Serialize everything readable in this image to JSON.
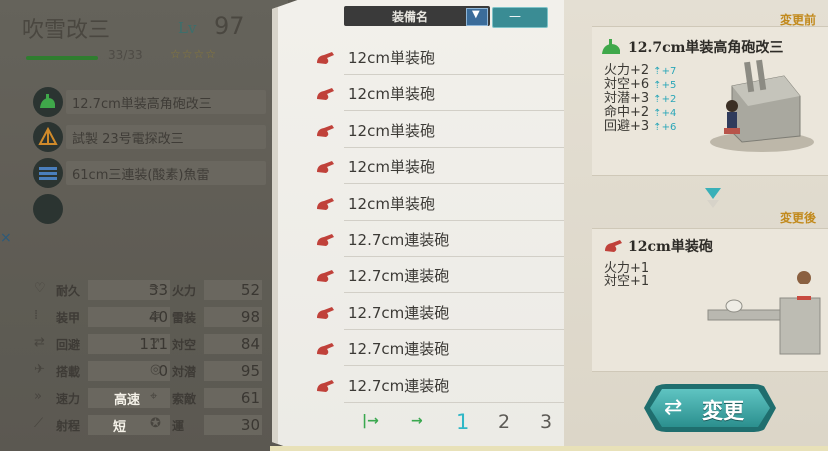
{
  "ship": {
    "name": "吹雪改三",
    "level_label": "Lv",
    "level": "97",
    "hp": "33/33",
    "stars": "☆☆☆☆"
  },
  "equipment_slots": [
    {
      "label": "12.7cm単装高角砲改三",
      "icon": "aa-gun-icon",
      "icon_color": "#3fa84a"
    },
    {
      "label": "試製 23号電探改三",
      "icon": "radar-icon",
      "icon_color": "#d08a2a"
    },
    {
      "label": "61cm三連装(酸素)魚雷",
      "icon": "torpedo-icon",
      "icon_color": "#3f6fa8"
    },
    {
      "label": "",
      "icon": "empty-slot-icon",
      "icon_color": "#2b3431"
    }
  ],
  "stats": [
    {
      "name": "耐久",
      "value": "33",
      "icon": "heart-icon"
    },
    {
      "name": "火力",
      "value": "52",
      "icon": "cannon-icon"
    },
    {
      "name": "装甲",
      "value": "40",
      "icon": "armor-icon"
    },
    {
      "name": "雷装",
      "value": "98",
      "icon": "torpedo-stat-icon"
    },
    {
      "name": "回避",
      "value": "111",
      "icon": "evasion-icon"
    },
    {
      "name": "対空",
      "value": "84",
      "icon": "anti-air-icon"
    },
    {
      "name": "搭載",
      "value": "0",
      "icon": "plane-icon"
    },
    {
      "name": "対潜",
      "value": "95",
      "icon": "anti-sub-icon"
    },
    {
      "name": "速力",
      "value": "高速",
      "icon": "speed-icon"
    },
    {
      "name": "索敵",
      "value": "61",
      "icon": "los-icon"
    },
    {
      "name": "射程",
      "value": "短",
      "icon": "range-icon"
    },
    {
      "name": "運",
      "value": "30",
      "icon": "luck-icon"
    }
  ],
  "list": {
    "header": "装備名",
    "sort_dropdown": "▼",
    "sort_button": "—",
    "items": [
      "12cm単装砲",
      "12cm単装砲",
      "12cm単装砲",
      "12cm単装砲",
      "12cm単装砲",
      "12.7cm連装砲",
      "12.7cm連装砲",
      "12.7cm連装砲",
      "12.7cm連装砲",
      "12.7cm連装砲"
    ],
    "gun_icon_color": "#c0413a"
  },
  "pager": {
    "first": "|→",
    "prev": "→",
    "pages": [
      "1",
      "2",
      "3"
    ],
    "current": "1"
  },
  "before": {
    "tag": "変更前",
    "name": "12.7cm単装高角砲改三",
    "bonuses": [
      {
        "text": "火力+2",
        "up": "+7"
      },
      {
        "text": "対空+6",
        "up": "+5"
      },
      {
        "text": "対潜+3",
        "up": "+2"
      },
      {
        "text": "命中+2",
        "up": "+4"
      },
      {
        "text": "回避+3",
        "up": "+6"
      }
    ]
  },
  "after": {
    "tag": "変更後",
    "name": "12cm単装砲",
    "bonuses": [
      "火力+1",
      "対空+1"
    ]
  },
  "change_button": "変更",
  "colors": {
    "accent_teal": "#2fb7c6",
    "tag_orange": "#c28a1d",
    "hp_green": "#2f7d2f"
  }
}
